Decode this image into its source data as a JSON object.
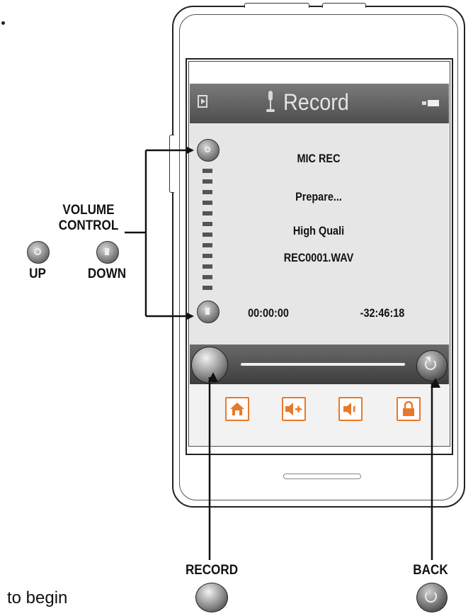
{
  "screen": {
    "title": "Record",
    "mode": "MIC REC",
    "status": "Prepare...",
    "quality": "High Quali",
    "filename": "REC0001.WAV",
    "elapsed": "00:00:00",
    "remaining": "-32:46:18"
  },
  "labels": {
    "volume_line1": "VOLUME",
    "volume_line2": "CONTROL",
    "up": "UP",
    "down": "DOWN",
    "record": "RECORD",
    "back": "BACK",
    "fragment_left": "to begin"
  },
  "toolbar": {
    "icons": [
      "home-icon",
      "volume-up-icon",
      "volume-down-icon",
      "lock-icon"
    ],
    "accent": "#e9792a"
  },
  "colors": {
    "title_bar": "#5b5b5b",
    "screen_bg": "#e6e6e6",
    "accent": "#e9792a"
  }
}
